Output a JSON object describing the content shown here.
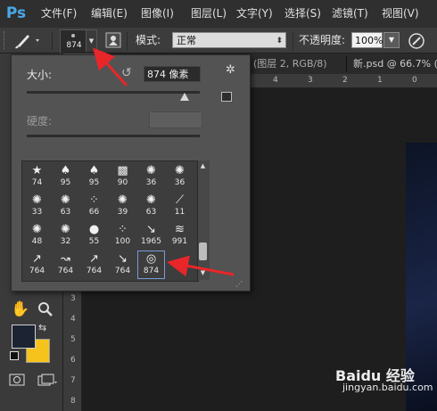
{
  "app": {
    "logo": "Ps"
  },
  "menubar": {
    "items": [
      "文件(F)",
      "编辑(E)",
      "图像(I)",
      "图层(L)",
      "文字(Y)",
      "选择(S)",
      "滤镜(T)",
      "视图(V)"
    ]
  },
  "options_bar": {
    "brush_preset_size": "874",
    "mode_label": "模式:",
    "mode_value": "正常",
    "opacity_label": "不透明度:",
    "opacity_value": "100%"
  },
  "document": {
    "tab1": "(图层 2, RGB/8)",
    "tab2": "新.psd @ 66.7% (",
    "ruler_h_numbers": [
      "4",
      "3",
      "2",
      "1",
      "0"
    ],
    "ruler_v_numbers": [
      "3",
      "4",
      "5",
      "6",
      "7",
      "8"
    ]
  },
  "brush_picker": {
    "size_label": "大小:",
    "size_value": "874 像素",
    "hardness_label": "硬度:",
    "presets": [
      {
        "icon": "star-brush-icon",
        "glyph": "★",
        "size": "74"
      },
      {
        "icon": "leaf-brush-icon",
        "glyph": "♠",
        "size": "95"
      },
      {
        "icon": "leaf-brush-icon",
        "glyph": "♠",
        "size": "95"
      },
      {
        "icon": "texture-brush-icon",
        "glyph": "▩",
        "size": "90"
      },
      {
        "icon": "splatter-brush-icon",
        "glyph": "✺",
        "size": "36"
      },
      {
        "icon": "splatter-brush-icon",
        "glyph": "✺",
        "size": "36"
      },
      {
        "icon": "splatter-brush-icon",
        "glyph": "✺",
        "size": "33"
      },
      {
        "icon": "splatter-brush-icon",
        "glyph": "✺",
        "size": "63"
      },
      {
        "icon": "speckle-brush-icon",
        "glyph": "⁘",
        "size": "66"
      },
      {
        "icon": "splatter-brush-icon",
        "glyph": "✺",
        "size": "39"
      },
      {
        "icon": "splatter-brush-icon",
        "glyph": "✺",
        "size": "63"
      },
      {
        "icon": "stroke-brush-icon",
        "glyph": "⟋",
        "size": "11"
      },
      {
        "icon": "splatter-brush-icon",
        "glyph": "✺",
        "size": "48"
      },
      {
        "icon": "splatter-brush-icon",
        "glyph": "✺",
        "size": "32"
      },
      {
        "icon": "round-soft-brush-icon",
        "glyph": "●",
        "size": "55"
      },
      {
        "icon": "speckle-brush-icon",
        "glyph": "⁘",
        "size": "100"
      },
      {
        "icon": "pin-brush-icon",
        "glyph": "↘",
        "size": "1965"
      },
      {
        "icon": "wave-brush-icon",
        "glyph": "≋",
        "size": "991"
      },
      {
        "icon": "arrow-brush-icon",
        "glyph": "↗",
        "size": "764"
      },
      {
        "icon": "arrow-brush-icon",
        "glyph": "↝",
        "size": "764"
      },
      {
        "icon": "arrow-brush-icon",
        "glyph": "↗",
        "size": "764"
      },
      {
        "icon": "arrow-brush-icon",
        "glyph": "↘",
        "size": "764"
      },
      {
        "icon": "eye-brush-icon",
        "glyph": "◎",
        "size": "874",
        "selected": true
      }
    ]
  },
  "colors": {
    "foreground": "#1c2333",
    "background": "#f6c21c",
    "annotation_arrow": "#e8262a",
    "selection_outline": "#7a9bd8"
  },
  "watermark": {
    "line1": "Baidu 经验",
    "line2": "jingyan.baidu.com"
  }
}
